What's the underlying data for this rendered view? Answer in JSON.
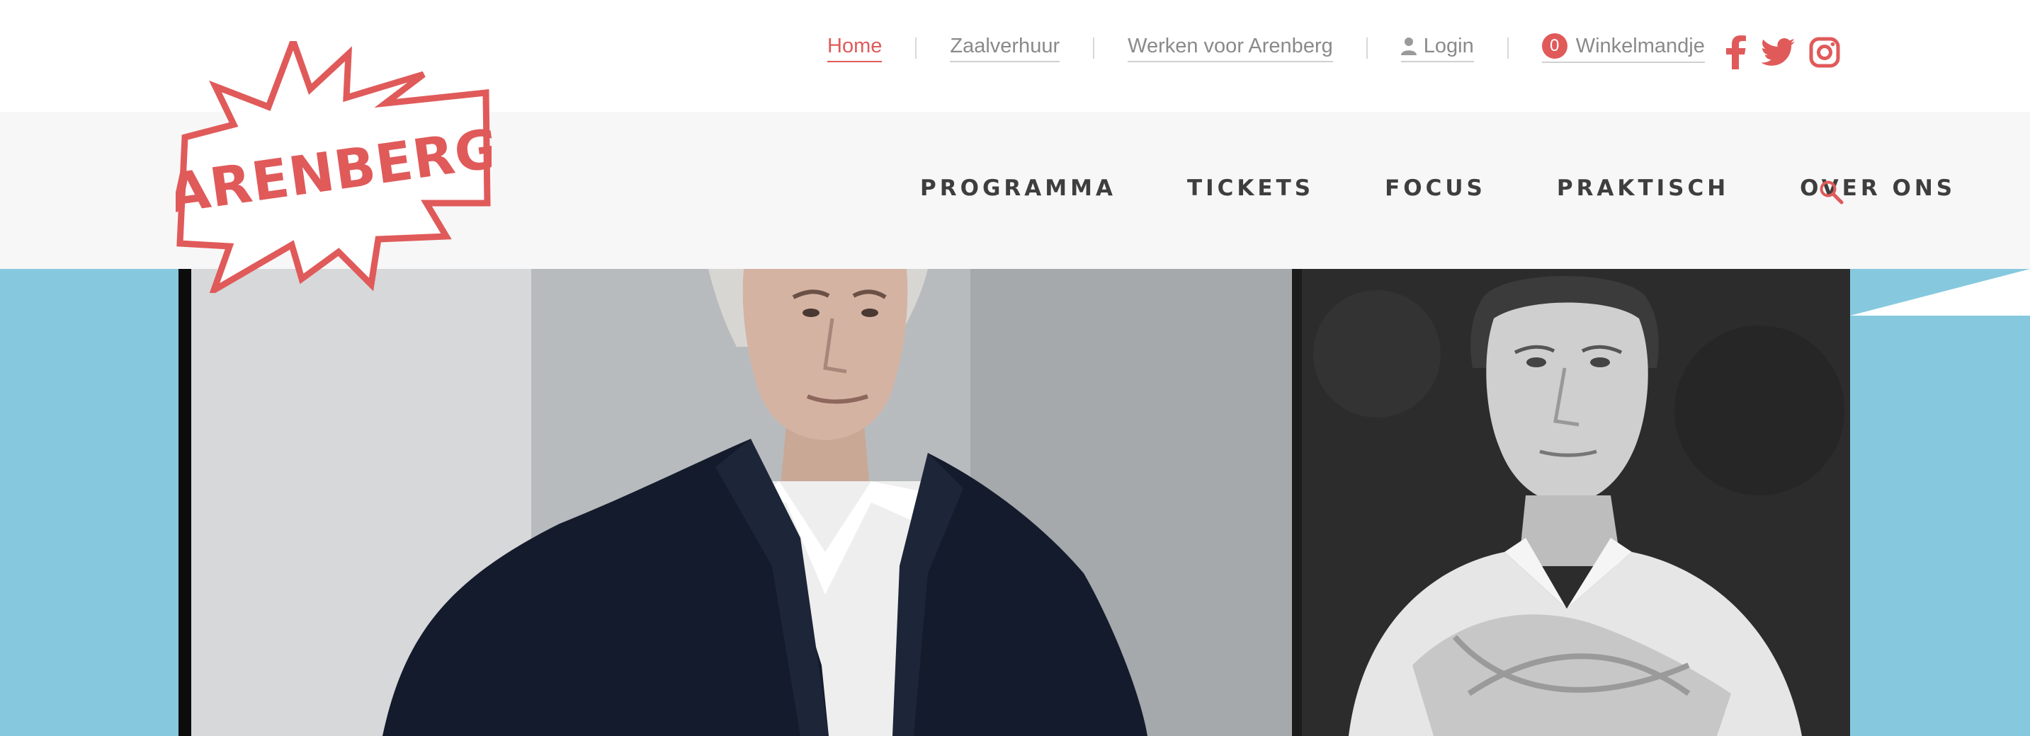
{
  "utility_nav": {
    "home": "Home",
    "zaalverhuur": "Zaalverhuur",
    "werken": "Werken voor Arenberg",
    "login": "Login",
    "cart_count": "0",
    "cart_label": "Winkelmandje"
  },
  "social": [
    "facebook-icon",
    "twitter-icon",
    "instagram-icon"
  ],
  "logo": {
    "text": "ARENBERG"
  },
  "main_nav": {
    "items": [
      {
        "label": "PROGRAMMA"
      },
      {
        "label": "TICKETS"
      },
      {
        "label": "FOCUS"
      },
      {
        "label": "PRAKTISCH"
      },
      {
        "label": "OVER ONS"
      }
    ]
  },
  "colors": {
    "accent": "#e05a5a",
    "hero_background": "#86c9de",
    "nav_text": "#3e3e3e",
    "band_gray": "#f7f7f7"
  }
}
